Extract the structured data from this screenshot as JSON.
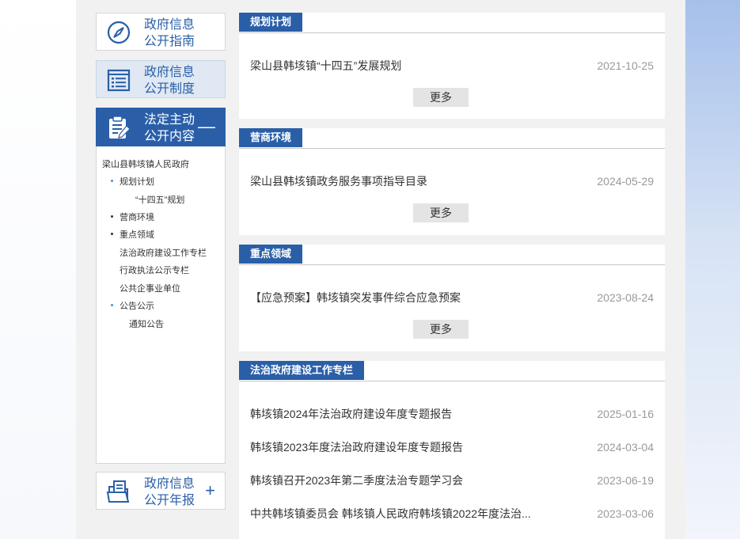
{
  "left_nav": {
    "card1": {
      "line1": "政府信息",
      "line2": "公开指南"
    },
    "card2": {
      "line1": "政府信息",
      "line2": "公开制度"
    },
    "card3": {
      "line1": "法定主动",
      "line2": "公开内容",
      "sign": "—"
    },
    "card4": {
      "line1": "政府信息",
      "line2": "公开年报",
      "sign": "+"
    },
    "tree": [
      {
        "label": "梁山县韩垓镇人民政府"
      },
      {
        "label": "规划计划"
      },
      {
        "label": "“十四五”规划"
      },
      {
        "label": "营商环境"
      },
      {
        "label": "重点领域"
      },
      {
        "label": "法治政府建设工作专栏"
      },
      {
        "label": "行政执法公示专栏"
      },
      {
        "label": "公共企事业单位"
      },
      {
        "label": "公告公示"
      },
      {
        "label": "通知公告"
      }
    ]
  },
  "sections": [
    {
      "title": "规划计划",
      "items": [
        {
          "title": "梁山县韩垓镇“十四五”发展规划",
          "date": "2021-10-25"
        }
      ],
      "more": "更多"
    },
    {
      "title": "营商环境",
      "items": [
        {
          "title": "梁山县韩垓镇政务服务事项指导目录",
          "date": "2024-05-29"
        }
      ],
      "more": "更多"
    },
    {
      "title": "重点领域",
      "items": [
        {
          "title": "【应急预案】韩垓镇突发事件综合应急预案",
          "date": "2023-08-24"
        }
      ],
      "more": "更多"
    },
    {
      "title": "法治政府建设工作专栏",
      "items": [
        {
          "title": "韩垓镇2024年法治政府建设年度专题报告",
          "date": "2025-01-16"
        },
        {
          "title": "韩垓镇2023年度法治政府建设年度专题报告",
          "date": "2024-03-04"
        },
        {
          "title": "韩垓镇召开2023年第二季度法治专题学习会",
          "date": "2023-06-19"
        },
        {
          "title": "中共韩垓镇委员会 韩垓镇人民政府韩垓镇2022年度法治...",
          "date": "2023-03-06"
        }
      ]
    }
  ],
  "colors": {
    "accent": "#2a5fa8",
    "dot_blue": "#4a8fd8",
    "dot_dark": "#333333"
  }
}
